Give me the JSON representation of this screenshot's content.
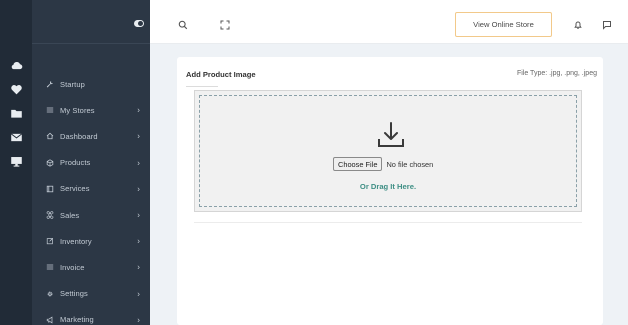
{
  "rail": {
    "icons": [
      "cloud-icon",
      "heart-icon",
      "folder-icon",
      "mail-icon",
      "monitor-icon"
    ]
  },
  "sidebar": {
    "items": [
      {
        "label": "Startup",
        "icon": "wrench-icon",
        "has_chevron": false
      },
      {
        "label": "My Stores",
        "icon": "list-icon",
        "has_chevron": true
      },
      {
        "label": "Dashboard",
        "icon": "home-icon",
        "has_chevron": true
      },
      {
        "label": "Products",
        "icon": "cube-icon",
        "has_chevron": true
      },
      {
        "label": "Services",
        "icon": "square-icon",
        "has_chevron": true
      },
      {
        "label": "Sales",
        "icon": "command-icon",
        "has_chevron": true
      },
      {
        "label": "Inventory",
        "icon": "edit-icon",
        "has_chevron": true
      },
      {
        "label": "Invoice",
        "icon": "list-icon",
        "has_chevron": true
      },
      {
        "label": "Settings",
        "icon": "gear-icon",
        "has_chevron": true
      },
      {
        "label": "Marketing",
        "icon": "megaphone-icon",
        "has_chevron": true
      }
    ],
    "chevron": "›"
  },
  "header": {
    "view_store_label": "View Online Store"
  },
  "upload": {
    "title": "Add Product Image",
    "file_type": "File Type: .jpg, .png, .jpeg",
    "choose_button": "Choose File",
    "no_file": "No file chosen",
    "drag_text": "Or Drag It Here."
  },
  "colors": {
    "rail_bg": "#212b37",
    "sidebar_bg": "#2c3745",
    "accent_teal": "#3f8f85",
    "button_border": "#f2c98a"
  }
}
